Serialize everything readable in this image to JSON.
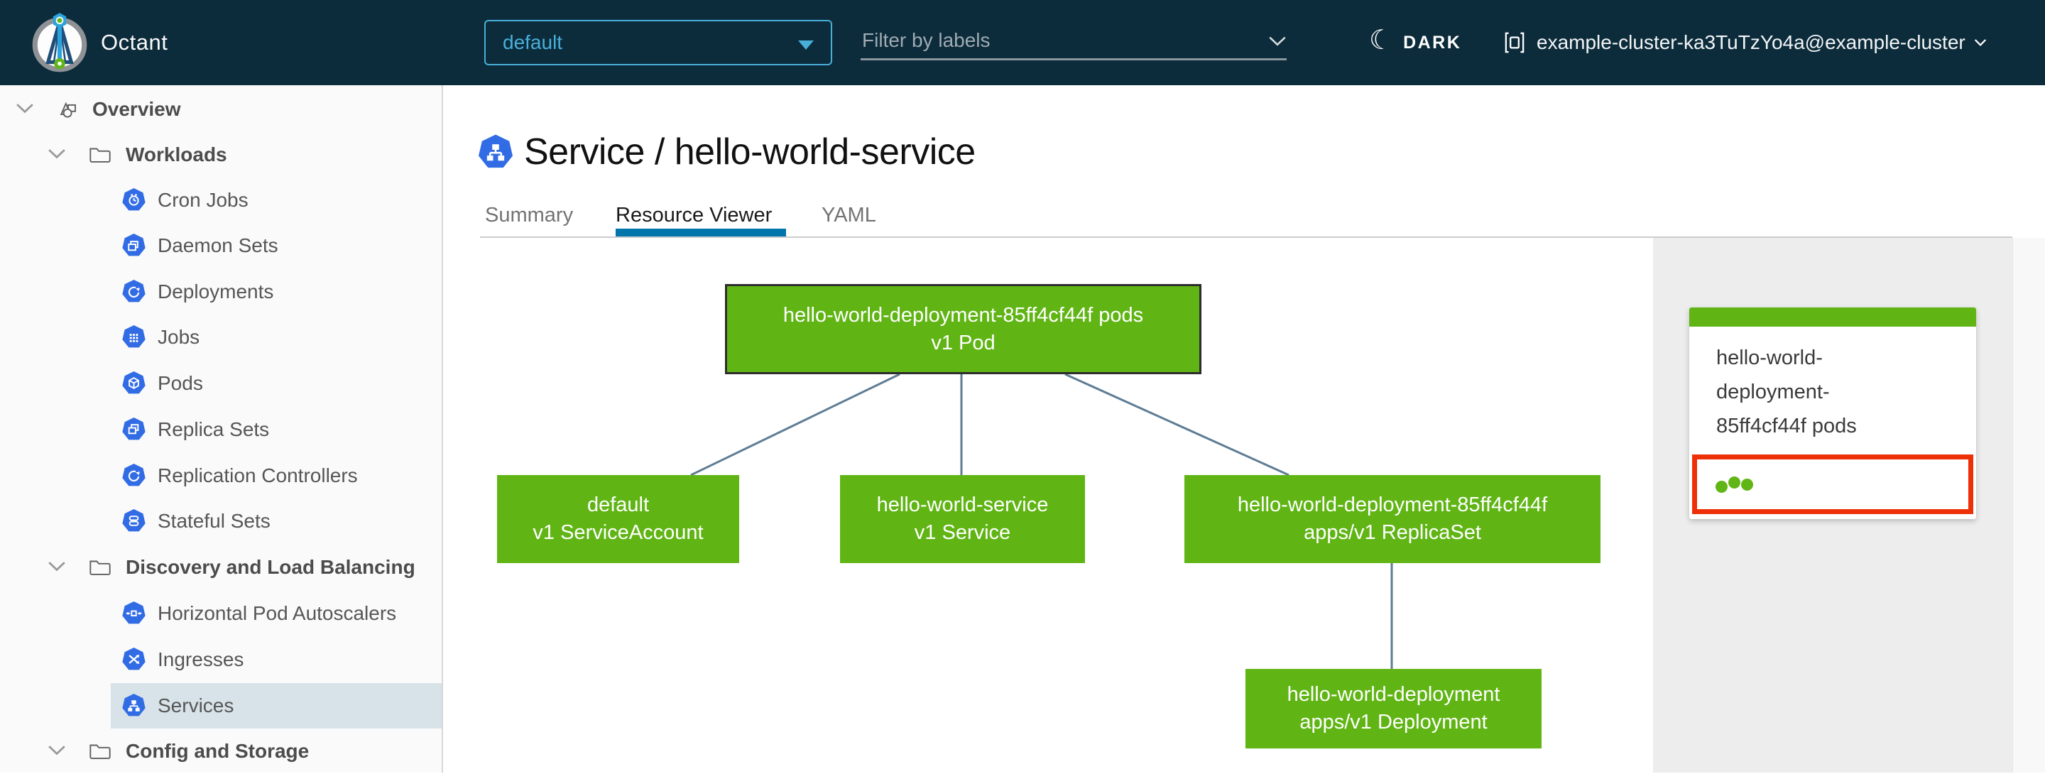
{
  "header": {
    "app_title": "Octant",
    "namespace_dropdown": {
      "value": "default"
    },
    "filter": {
      "placeholder": "Filter by labels"
    },
    "theme_toggle": {
      "label": "DARK"
    },
    "cluster": {
      "label": "example-cluster-ka3TuTzYo4a@example-cluster"
    }
  },
  "sidebar": {
    "items": [
      {
        "label": "Overview",
        "icon": "objects-icon",
        "level": 0,
        "expanded": true
      },
      {
        "label": "Workloads",
        "icon": "folder-icon",
        "level": 1,
        "expanded": true
      },
      {
        "label": "Cron Jobs",
        "icon": "cron-jobs-icon",
        "level": 2
      },
      {
        "label": "Daemon Sets",
        "icon": "daemon-sets-icon",
        "level": 2
      },
      {
        "label": "Deployments",
        "icon": "deployments-icon",
        "level": 2
      },
      {
        "label": "Jobs",
        "icon": "jobs-icon",
        "level": 2
      },
      {
        "label": "Pods",
        "icon": "pods-icon",
        "level": 2
      },
      {
        "label": "Replica Sets",
        "icon": "replica-sets-icon",
        "level": 2
      },
      {
        "label": "Replication Controllers",
        "icon": "replication-controllers-icon",
        "level": 2
      },
      {
        "label": "Stateful Sets",
        "icon": "stateful-sets-icon",
        "level": 2
      },
      {
        "label": "Discovery and Load Balancing",
        "icon": "folder-icon",
        "level": 1,
        "expanded": true
      },
      {
        "label": "Horizontal Pod Autoscalers",
        "icon": "hpa-icon",
        "level": 2
      },
      {
        "label": "Ingresses",
        "icon": "ingresses-icon",
        "level": 2
      },
      {
        "label": "Services",
        "icon": "services-icon",
        "level": 2,
        "selected": true
      },
      {
        "label": "Config and Storage",
        "icon": "folder-icon",
        "level": 1,
        "expanded": true
      }
    ]
  },
  "page": {
    "title": "Service / hello-world-service",
    "tabs": [
      {
        "label": "Summary",
        "active": false
      },
      {
        "label": "Resource Viewer",
        "active": true
      },
      {
        "label": "YAML",
        "active": false
      }
    ]
  },
  "graph": {
    "nodes": [
      {
        "id": "pod",
        "line1": "hello-world-deployment-85ff4cf44f pods",
        "line2": "v1 Pod",
        "selected": true
      },
      {
        "id": "serviceaccount",
        "line1": "default",
        "line2": "v1 ServiceAccount",
        "selected": false
      },
      {
        "id": "service",
        "line1": "hello-world-service",
        "line2": "v1 Service",
        "selected": false
      },
      {
        "id": "replicaset",
        "line1": "hello-world-deployment-85ff4cf44f",
        "line2": "apps/v1 ReplicaSet",
        "selected": false
      },
      {
        "id": "deployment",
        "line1": "hello-world-deployment",
        "line2": "apps/v1 Deployment",
        "selected": false
      }
    ],
    "edges": [
      [
        "pod",
        "serviceaccount"
      ],
      [
        "pod",
        "service"
      ],
      [
        "pod",
        "replicaset"
      ],
      [
        "replicaset",
        "deployment"
      ]
    ]
  },
  "detail_panel": {
    "card": {
      "title": "hello-world-deployment-85ff4cf44f pods",
      "status_dots": 3,
      "highlighted": true
    }
  },
  "colors": {
    "header_bg": "#0c2b3b",
    "accent_blue": "#49afd9",
    "k8s_blue": "#326ce5",
    "node_green": "#60b515",
    "edge_blue": "#5e7d95",
    "red_highlight": "#ee3008",
    "tab_underline": "#0076ad",
    "selected_nav_bg": "#d8e3e9"
  }
}
